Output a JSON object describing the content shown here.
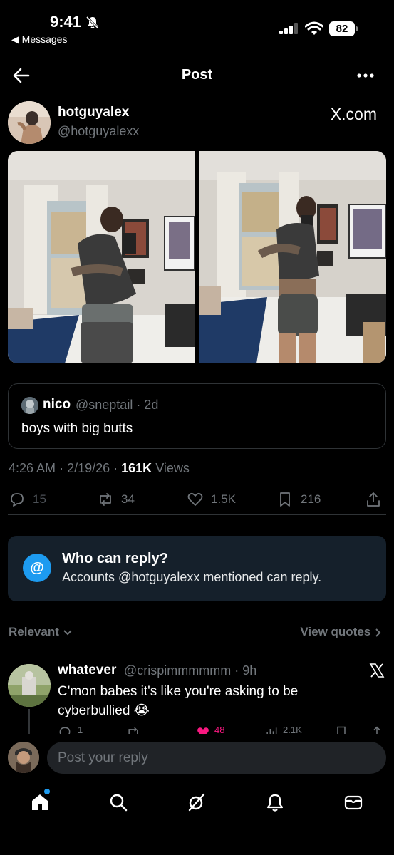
{
  "status_bar": {
    "time": "9:41",
    "back_app": "◀ Messages",
    "battery": "82"
  },
  "nav": {
    "title": "Post"
  },
  "post": {
    "author_name": "hotguyalex",
    "author_handle": "@hotguyalexx",
    "watermark": "X.com",
    "quote": {
      "name": "nico",
      "handle_time": "@sneptail · 2d",
      "text": "boys with big butts"
    },
    "time": "4:26 AM",
    "date": "2/19/26",
    "views_count": "161K",
    "views_label": "Views",
    "actions": {
      "replies": "15",
      "reposts": "34",
      "likes": "1.5K",
      "bookmarks": "216"
    }
  },
  "who_can_reply": {
    "icon": "@",
    "title": "Who can reply?",
    "subtitle": "Accounts @hotguyalexx mentioned can reply."
  },
  "sort": {
    "relevant": "Relevant",
    "view_quotes": "View quotes"
  },
  "reply": {
    "name": "whatever",
    "handle_time": "@crispimmmmmm · 9h",
    "text": "C'mon babes it's like you're asking to be cyberbullied 😭",
    "replies": "1",
    "likes": "48",
    "views": "2.1K"
  },
  "composer": {
    "placeholder": "Post your reply"
  },
  "colors": {
    "accent": "#1d9bf0",
    "like": "#f91880",
    "muted": "#71767b",
    "card": "#15202b"
  }
}
